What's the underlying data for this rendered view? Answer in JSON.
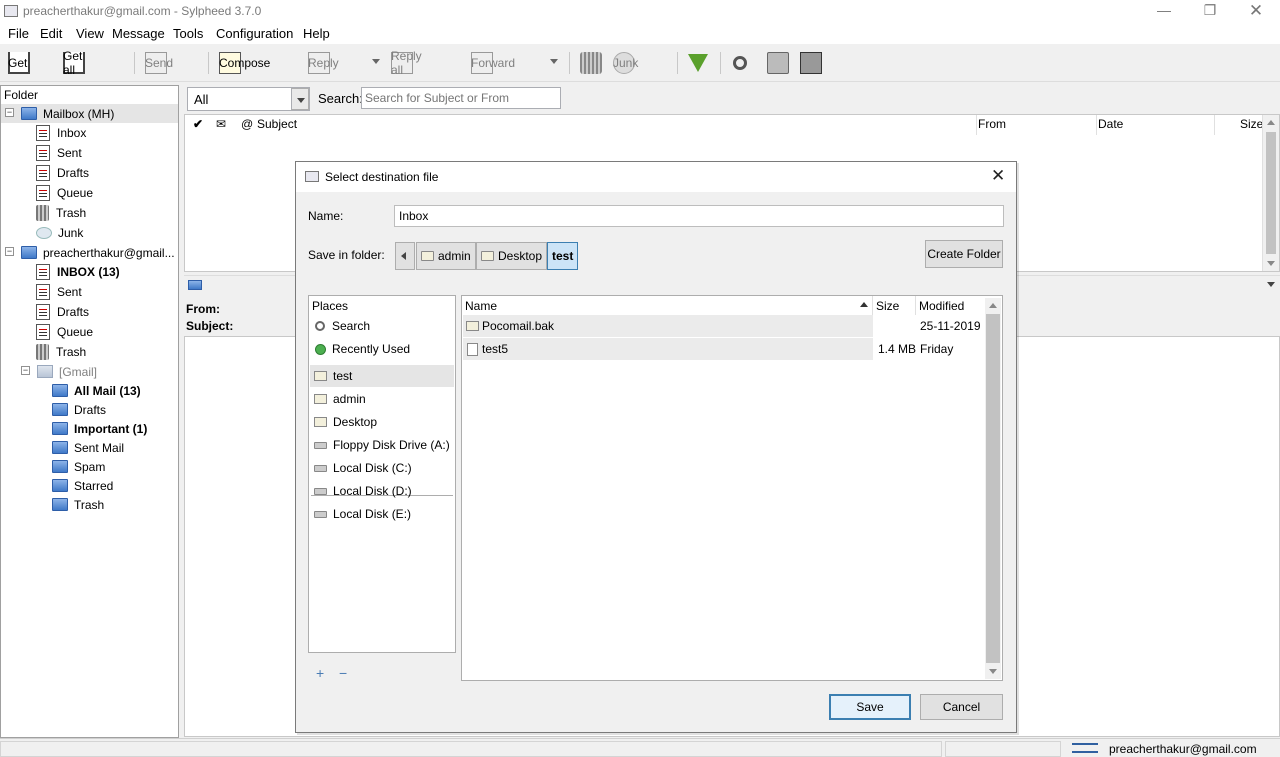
{
  "window": {
    "title": "preacherthakur@gmail.com - Sylpheed 3.7.0"
  },
  "menu": [
    "File",
    "Edit",
    "View",
    "Message",
    "Tools",
    "Configuration",
    "Help"
  ],
  "toolbar": {
    "get": "Get",
    "get_all": "Get all",
    "send": "Send",
    "compose": "Compose",
    "reply": "Reply",
    "reply_all": "Reply all",
    "forward": "Forward",
    "junk": "Junk"
  },
  "folders": {
    "header": "Folder",
    "mailbox": {
      "label": "Mailbox (MH)",
      "children": [
        "Inbox",
        "Sent",
        "Drafts",
        "Queue",
        "Trash",
        "Junk"
      ]
    },
    "account": {
      "label": "preacherthakur@gmail...",
      "children": [
        "INBOX (13)",
        "Sent",
        "Drafts",
        "Queue",
        "Trash"
      ]
    },
    "gmail": {
      "label": "[Gmail]",
      "children": [
        "All Mail (13)",
        "Drafts",
        "Important (1)",
        "Sent Mail",
        "Spam",
        "Starred",
        "Trash"
      ]
    }
  },
  "filter": {
    "value": "All",
    "search_label": "Search:",
    "search_placeholder": "Search for Subject or From"
  },
  "message_list": {
    "columns": [
      "Subject",
      "From",
      "Date",
      "Size"
    ]
  },
  "message_header": {
    "from": "From:",
    "subject": "Subject:"
  },
  "status": {
    "account": "preacherthakur@gmail.com"
  },
  "dialog": {
    "title": "Select destination file",
    "name_label": "Name:",
    "name_value": "Inbox",
    "save_in_label": "Save in folder:",
    "breadcrumbs": [
      "admin",
      "Desktop",
      "test"
    ],
    "create_folder": "Create Folder",
    "places_header": "Places",
    "places": [
      "Search",
      "Recently Used",
      "test",
      "admin",
      "Desktop",
      "Floppy Disk Drive (A:)",
      "Local Disk (C:)",
      "Local Disk (D:)",
      "Local Disk (E:)"
    ],
    "files_columns": [
      "Name",
      "Size",
      "Modified"
    ],
    "files": [
      {
        "name": "Pocomail.bak",
        "size": "",
        "modified": "25-11-2019",
        "type": "folder"
      },
      {
        "name": "test5",
        "size": "1.4 MB",
        "modified": "Friday",
        "type": "file"
      }
    ],
    "save": "Save",
    "cancel": "Cancel",
    "add_place": "+",
    "remove_place": "−"
  }
}
